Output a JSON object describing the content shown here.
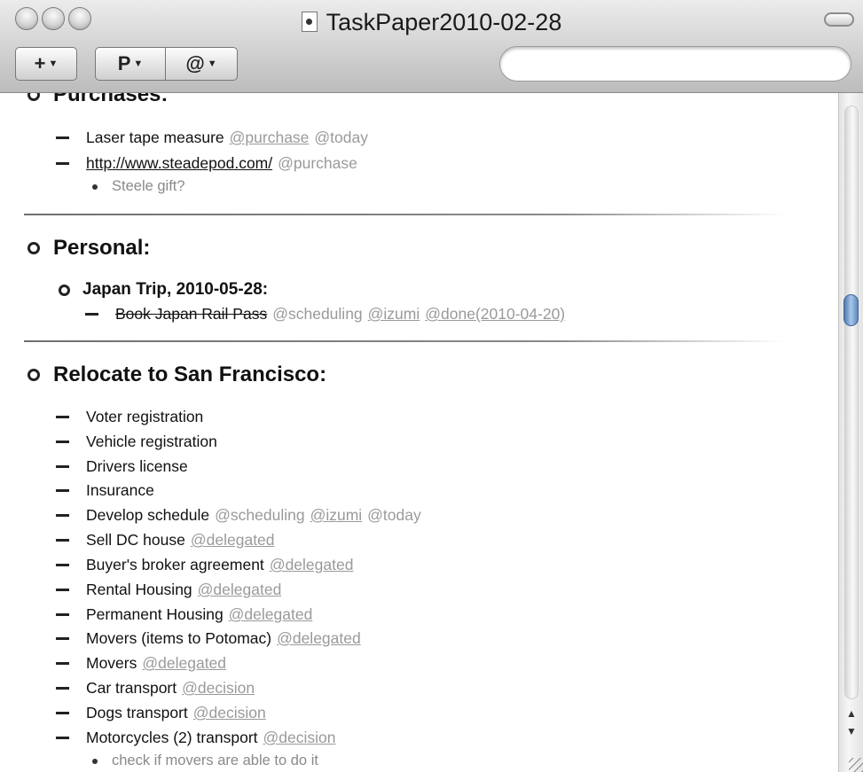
{
  "window": {
    "title": "TaskPaper2010-02-28"
  },
  "toolbar": {
    "add_label": "+",
    "project_label": "P",
    "tag_label": "@",
    "search_placeholder": ""
  },
  "document": {
    "purchases": {
      "title": "Purchases:",
      "tasks": [
        {
          "text": "Laser tape measure",
          "tags": [
            "@purchase",
            "@today"
          ]
        },
        {
          "text": "http://www.steadepod.com/",
          "tags": [
            "@purchase"
          ]
        }
      ],
      "note": "Steele gift?"
    },
    "personal": {
      "title": "Personal:",
      "subproject": "Japan Trip, 2010-05-28:",
      "subtask": {
        "text": "Book Japan Rail Pass",
        "tags": [
          "@scheduling",
          "@izumi",
          "@done(2010-04-20)"
        ]
      }
    },
    "relocate": {
      "title": "Relocate to San Francisco:",
      "tasks": [
        {
          "text": "Voter registration",
          "tags": []
        },
        {
          "text": "Vehicle registration",
          "tags": []
        },
        {
          "text": "Drivers license",
          "tags": []
        },
        {
          "text": "Insurance",
          "tags": []
        },
        {
          "text": "Develop schedule",
          "tags": [
            "@scheduling",
            "@izumi",
            "@today"
          ]
        },
        {
          "text": "Sell DC house",
          "tags": [
            "@delegated"
          ]
        },
        {
          "text": "Buyer's broker agreement",
          "tags": [
            "@delegated"
          ]
        },
        {
          "text": "Rental Housing",
          "tags": [
            "@delegated"
          ]
        },
        {
          "text": "Permanent Housing",
          "tags": [
            "@delegated"
          ]
        },
        {
          "text": "Movers (items to Potomac)",
          "tags": [
            "@delegated"
          ]
        },
        {
          "text": "Movers",
          "tags": [
            "@delegated"
          ]
        },
        {
          "text": "Car transport",
          "tags": [
            "@decision"
          ]
        },
        {
          "text": "Dogs transport",
          "tags": [
            "@decision"
          ]
        },
        {
          "text": "Motorcycles (2) transport",
          "tags": [
            "@decision"
          ]
        }
      ],
      "note": "check if movers are able to do it"
    }
  }
}
